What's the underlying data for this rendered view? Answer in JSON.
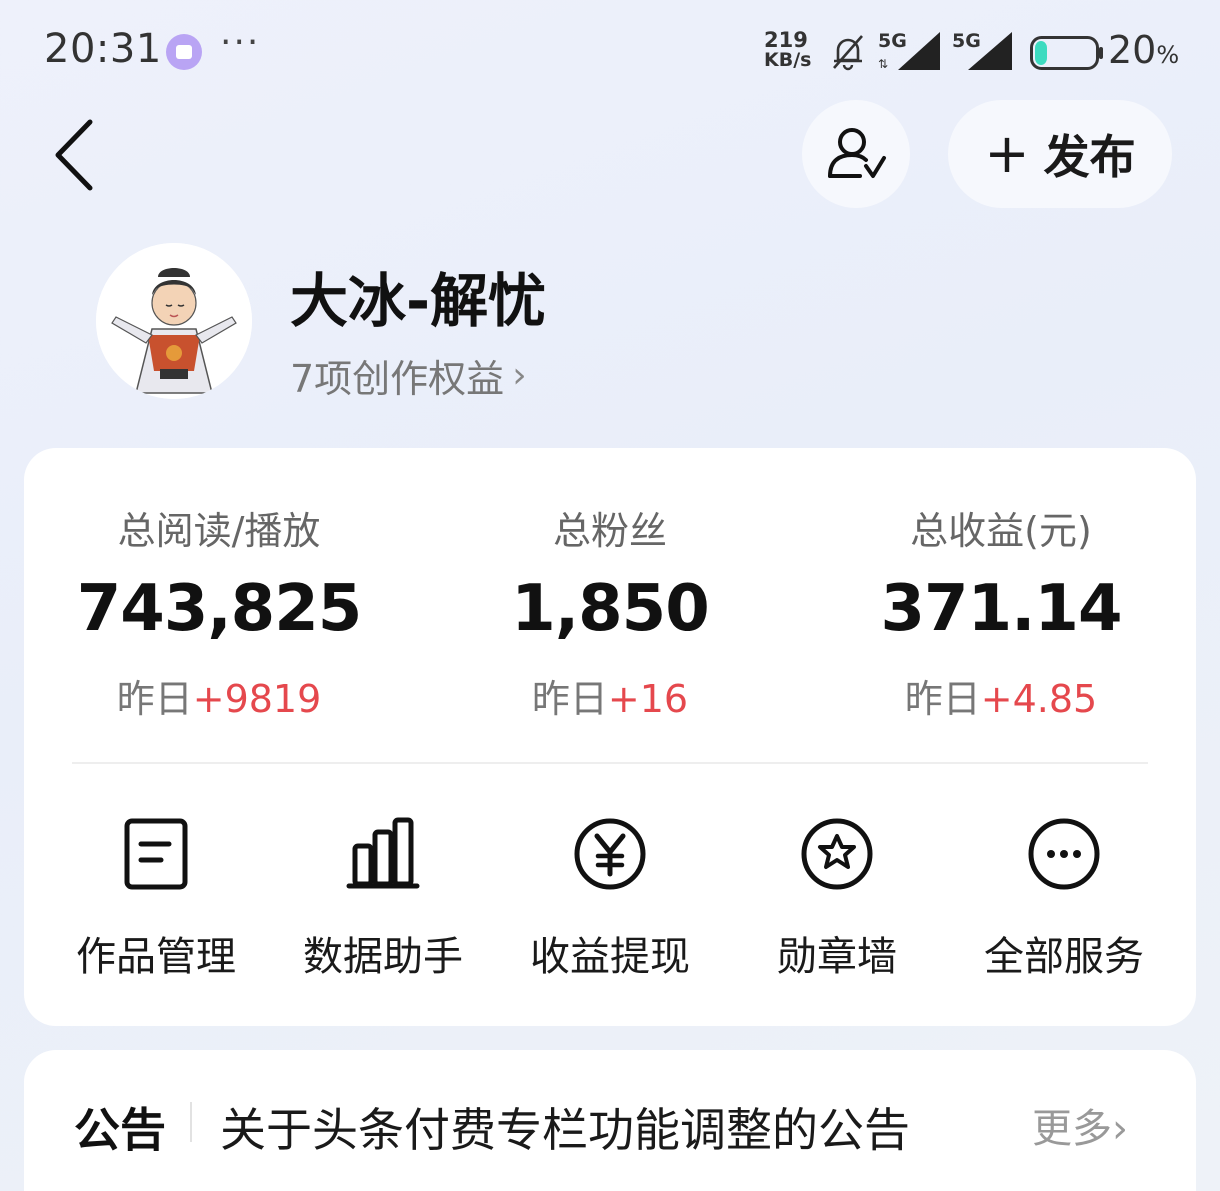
{
  "status_bar": {
    "time": "20:31",
    "more": "···",
    "net_speed_value": "219",
    "net_speed_unit": "KB/s",
    "signal_1": "5G",
    "signal_2": "5G",
    "battery_value": "20",
    "battery_unit": "%",
    "battery_level": 0.2,
    "battery_color": "#3ddbc0",
    "app_icon": "shopping-bag-icon"
  },
  "header": {
    "back_icon": "chevron-left-icon",
    "profile_switch_icon": "user-check-icon",
    "publish_plus": "+",
    "publish_label": "发布"
  },
  "profile": {
    "username": "大冰-解忧",
    "benefits_link": "7项创作权益",
    "benefits_chevron": "›"
  },
  "stats": [
    {
      "label": "总阅读/播放",
      "value": "743,825",
      "delta_prefix": "昨日",
      "delta_value": "+9819"
    },
    {
      "label": "总粉丝",
      "value": "1,850",
      "delta_prefix": "昨日",
      "delta_value": "+16"
    },
    {
      "label": "总收益(元)",
      "value": "371.14",
      "delta_prefix": "昨日",
      "delta_value": "+4.85"
    }
  ],
  "services": [
    {
      "label": "作品管理",
      "icon": "document-icon"
    },
    {
      "label": "数据助手",
      "icon": "bar-chart-icon"
    },
    {
      "label": "收益提现",
      "icon": "yuan-icon"
    },
    {
      "label": "勋章墙",
      "icon": "badge-star-icon"
    },
    {
      "label": "全部服务",
      "icon": "more-icon"
    }
  ],
  "notice": {
    "tag": "公告",
    "text": "关于头条付费专栏功能调整的公告",
    "more": "更多›"
  },
  "colors": {
    "accent_red": "#e5484d",
    "background": "#eef1fb"
  }
}
